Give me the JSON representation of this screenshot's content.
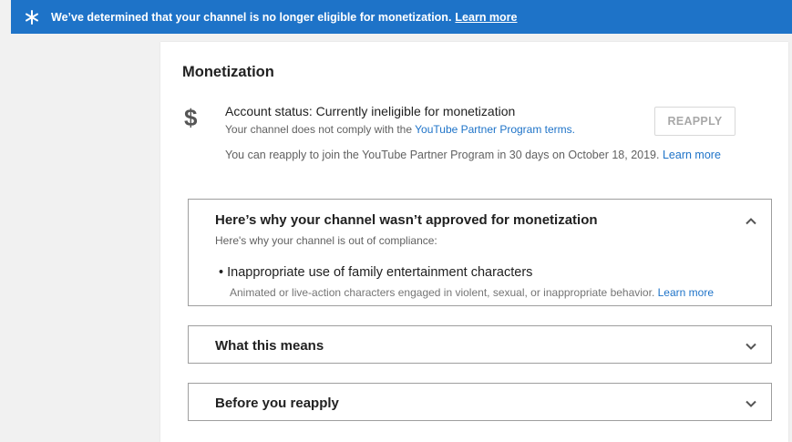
{
  "banner": {
    "icon": "star-icon",
    "message": "We’ve determined that your channel is no longer eligible for monetization.",
    "learn_more": "Learn more"
  },
  "monetization": {
    "title": "Monetization",
    "currency_icon": "dollar-icon",
    "currency_symbol": "$",
    "status": "Account status: Currently ineligible for monetization",
    "status_sub_prefix": "Your channel does not comply with the ",
    "status_sub_link": "YouTube Partner Program terms.",
    "reapply_button": "REAPPLY",
    "reapply_info": "You can reapply to join the YouTube Partner Program in 30 days on October 18, 2019.",
    "reapply_learn_more": "Learn more"
  },
  "panels": [
    {
      "title": "Here’s why your channel wasn’t approved for monetization",
      "expanded": true,
      "subtitle": "Here's why your channel is out of compliance:",
      "reason": "Inappropriate use of family entertainment characters",
      "reason_desc": "Animated or live-action characters engaged in violent, sexual, or inappropriate behavior.",
      "reason_learn_more": "Learn more"
    },
    {
      "title": "What this means",
      "expanded": false
    },
    {
      "title": "Before you reapply",
      "expanded": false
    }
  ],
  "colors": {
    "banner_bg": "#1e73c8",
    "link": "#1e73c8",
    "page_bg": "#f1f1f1"
  }
}
